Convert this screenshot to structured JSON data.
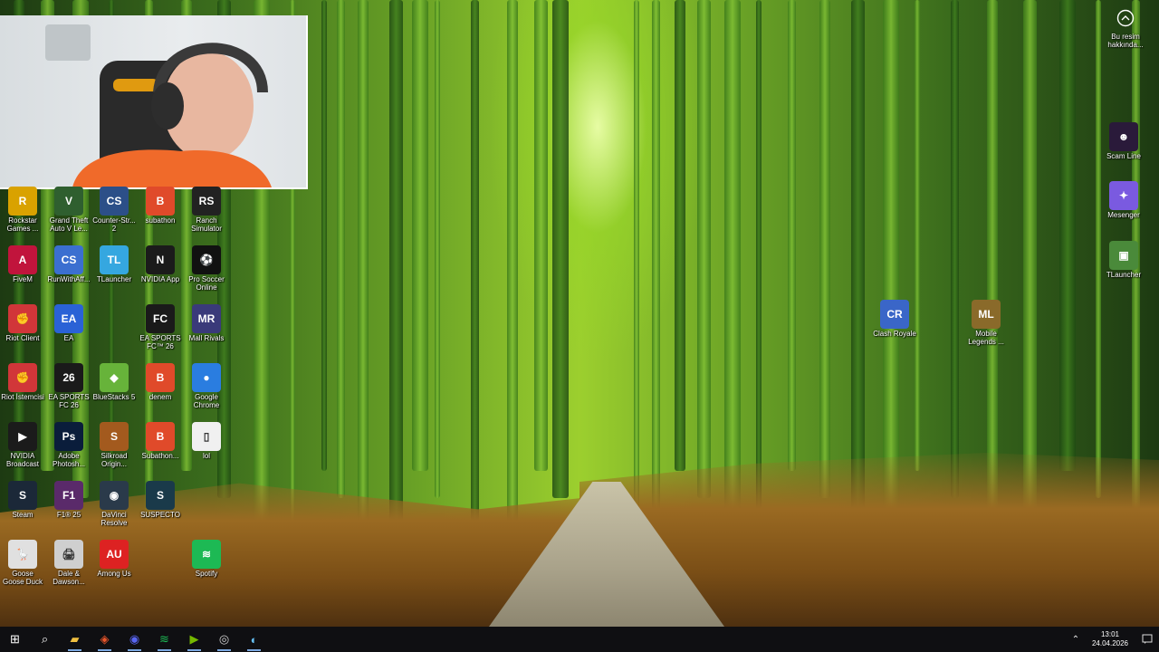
{
  "desktop_icons_left": [
    {
      "label": "Rockstar Games ...",
      "color": "#d9a200",
      "glyph": "R"
    },
    {
      "label": "Grand Theft Auto V Le...",
      "color": "#2f5f2f",
      "glyph": "V"
    },
    {
      "label": "Counter-Str... 2",
      "color": "#2c4f88",
      "glyph": "CS"
    },
    {
      "label": "subathon",
      "color": "#e04a2a",
      "glyph": "B"
    },
    {
      "label": "Ranch Simulator",
      "color": "#222222",
      "glyph": "RS"
    },
    {
      "label": "FiveM",
      "color": "#c1143c",
      "glyph": "A"
    },
    {
      "label": "RunWithAff...",
      "color": "#3b6fd0",
      "glyph": "CS"
    },
    {
      "label": "TLauncher",
      "color": "#35a7e0",
      "glyph": "TL"
    },
    {
      "label": "NVIDIA App",
      "color": "#1b1b1b",
      "glyph": "N"
    },
    {
      "label": "Pro Soccer Online",
      "color": "#111111",
      "glyph": "⚽"
    },
    {
      "label": "Riot Client",
      "color": "#d13639",
      "glyph": "✊"
    },
    {
      "label": "EA",
      "color": "#2a62d6",
      "glyph": "EA"
    },
    {
      "label": "EA SPORTS FC™ 26",
      "color": "#1a1a1a",
      "glyph": "FC"
    },
    {
      "label": "Mall Rivals",
      "color": "#3a3a7a",
      "glyph": "MR"
    },
    {
      "label": "Riot İstemcisi",
      "color": "#d13639",
      "glyph": "✊"
    },
    {
      "label": "EA SPORTS FC 26",
      "color": "#1a1a1a",
      "glyph": "26"
    },
    {
      "label": "BlueStacks 5",
      "color": "#67b33a",
      "glyph": "◆"
    },
    {
      "label": "denem",
      "color": "#e04a2a",
      "glyph": "B"
    },
    {
      "label": "Google Chrome",
      "color": "#2a7de0",
      "glyph": "●"
    },
    {
      "label": "NVIDIA Broadcast",
      "color": "#1b1b1b",
      "glyph": "▶"
    },
    {
      "label": "Adobe Photosh...",
      "color": "#0a1d3b",
      "glyph": "Ps"
    },
    {
      "label": "Silkroad Origin...",
      "color": "#a35a1e",
      "glyph": "S"
    },
    {
      "label": "Subathon...",
      "color": "#e04a2a",
      "glyph": "B"
    },
    {
      "label": "lol",
      "color": "#f0f0f0",
      "glyph": "▯"
    },
    {
      "label": "Steam",
      "color": "#1b2838",
      "glyph": "S"
    },
    {
      "label": "F1® 25",
      "color": "#5a2a6a",
      "glyph": "F1"
    },
    {
      "label": "DaVinci Resolve",
      "color": "#2a3a4a",
      "glyph": "◉"
    },
    {
      "label": "SUSPECTO",
      "color": "#1a3a4a",
      "glyph": "S"
    },
    {
      "label": "Goose Goose Duck",
      "color": "#e0e0e0",
      "glyph": "🪿"
    },
    {
      "label": "Dale & Dawson...",
      "color": "#cfcfcf",
      "glyph": "🖨"
    },
    {
      "label": "Among Us",
      "color": "#d22",
      "glyph": "AU"
    },
    {
      "label": "Spotify",
      "color": "#1db954",
      "glyph": "≋"
    }
  ],
  "desktop_icons_middle": [
    {
      "label": "Clash Royale",
      "color": "#3a66c8",
      "glyph": "CR"
    },
    {
      "label": "Mobile Legends ...",
      "color": "#8a6a2a",
      "glyph": "ML"
    }
  ],
  "desktop_icons_right": [
    {
      "label": "Scam Line",
      "color": "#2a1a3a",
      "glyph": "☻"
    },
    {
      "label": "Mesenger",
      "color": "#7a5ae0",
      "glyph": "✦"
    },
    {
      "label": "TLauncher",
      "color": "#4a8a3a",
      "glyph": "▣"
    }
  ],
  "notification": {
    "label": "Bu resim hakkında..."
  },
  "taskbar": {
    "buttons": [
      {
        "name": "start-button",
        "glyph": "⊞"
      },
      {
        "name": "search-button",
        "glyph": "⌕"
      },
      {
        "name": "file-explorer-button",
        "glyph": "▰"
      },
      {
        "name": "brave-button",
        "glyph": "◈"
      },
      {
        "name": "discord-button",
        "glyph": "◉"
      },
      {
        "name": "spotify-button",
        "glyph": "≋"
      },
      {
        "name": "nvidia-broadcast-button",
        "glyph": "▶"
      },
      {
        "name": "obs-button",
        "glyph": "◎"
      },
      {
        "name": "steam-button",
        "glyph": "◐"
      }
    ],
    "time": "13:01",
    "date": "24.04.2026"
  },
  "colors": {
    "taskbar": "#0f0f12",
    "accent": "#7aa7e0"
  }
}
